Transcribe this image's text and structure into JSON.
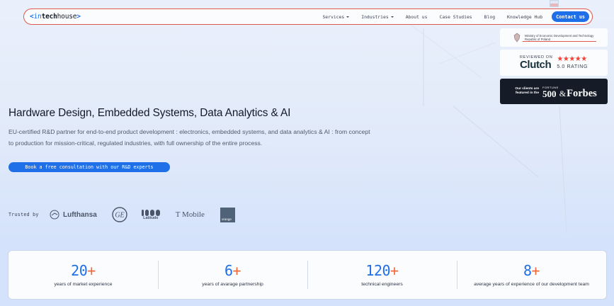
{
  "nav": {
    "logo": {
      "open": "<",
      "in": "in",
      "tech": "tech",
      "house": "house",
      "close": ">"
    },
    "links": [
      {
        "label": "Services",
        "dropdown": true
      },
      {
        "label": "Industries",
        "dropdown": true
      },
      {
        "label": "About us",
        "dropdown": false
      },
      {
        "label": "Case Studies",
        "dropdown": false
      },
      {
        "label": "Blog",
        "dropdown": false
      },
      {
        "label": "Knowledge Hub",
        "dropdown": false
      }
    ],
    "contact_label": "Contact us"
  },
  "badges": {
    "ministry": {
      "line1": "Ministry of Economic Development and Technology",
      "line2": "Republic of Poland"
    },
    "clutch": {
      "reviewed": "REVIEWED ON",
      "name": "Clutch",
      "stars": "★★★★★",
      "rating": "5.0 RATING"
    },
    "forbes": {
      "featured": "Our clients are featured in the",
      "fortune_top": "FORTUNE",
      "fortune_num": "500",
      "amp": "&",
      "forbes": "Forbes"
    }
  },
  "hero": {
    "title": "Hardware Design, Embedded Systems, Data Analytics & AI",
    "description": "EU-certified R&D partner for end-to-end product development : electronics, embedded systems, and data analytics & AI : from concept to production for mission-critical, regulated industries, with full ownership of the entire process.",
    "cta_label": "Book a free consultation with our R&D experts"
  },
  "trusted": {
    "label": "Trusted by",
    "logos": {
      "lufthansa": "Lufthansa",
      "latitude": "Latitude",
      "tmobile": "T Mobile",
      "orange": "orange"
    }
  },
  "stats": [
    {
      "value": "20",
      "suffix": "+",
      "label": "years of market experience"
    },
    {
      "value": "6",
      "suffix": "+",
      "label": "years of avarage partnership"
    },
    {
      "value": "120",
      "suffix": "+",
      "label": "technical engineers"
    },
    {
      "value": "8",
      "suffix": "+",
      "label": "average years of experience of our development team"
    }
  ],
  "colors": {
    "accent": "#1f6fe8",
    "plus": "#ef6a3a",
    "nav_border": "#e0584e",
    "dark_card": "#161c27"
  }
}
